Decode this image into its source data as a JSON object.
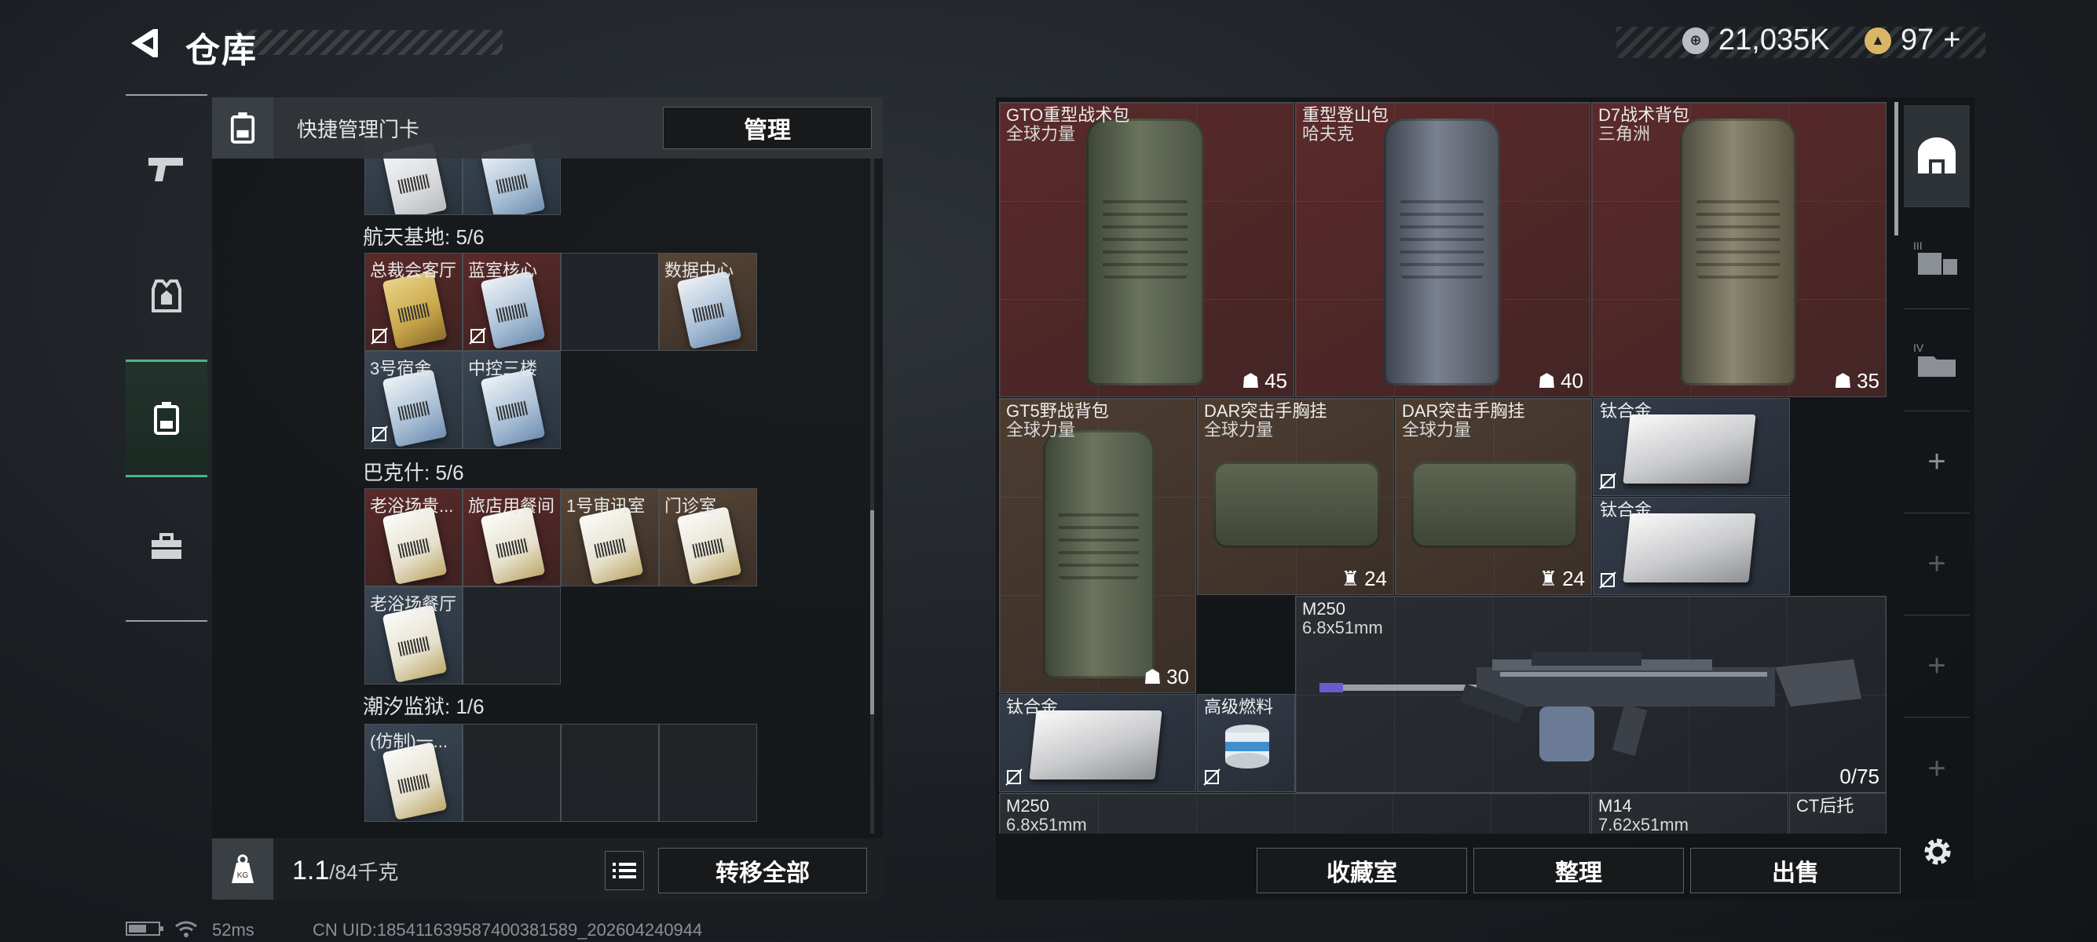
{
  "header": {
    "title": "仓库"
  },
  "currency": {
    "money": "21,035K",
    "coins": "97",
    "plus": "+"
  },
  "rail": {
    "items": [
      "weapon-icon",
      "armor-icon",
      "keycard-icon",
      "toolbox-icon"
    ]
  },
  "keycards": {
    "header_label": "快捷管理门卡",
    "manage_label": "管理",
    "groups": [
      {
        "title": "航天基地: 5/6",
        "slots": [
          "总裁会客厅",
          "蓝室核心",
          "",
          "数据中心",
          "3号宿舍",
          "中控三楼"
        ]
      },
      {
        "title": "巴克什: 5/6",
        "slots": [
          "老浴场贵...",
          "旅店用餐间",
          "1号审讯室",
          "门诊室",
          "老浴场餐厅"
        ]
      },
      {
        "title": "潮汐监狱: 1/6",
        "slots": [
          "(仿制)一..."
        ]
      }
    ],
    "weight_value": "1.1",
    "weight_max": "/84千克",
    "transfer_label": "转移全部"
  },
  "stash": {
    "items": [
      {
        "name": "GTO重型战术包",
        "sub": "全球力量",
        "cap": "45"
      },
      {
        "name": "重型登山包",
        "sub": "哈夫克",
        "cap": "40"
      },
      {
        "name": "D7战术背包",
        "sub": "三角洲",
        "cap": "35"
      },
      {
        "name": "GT5野战背包",
        "sub": "全球力量",
        "cap": "30"
      },
      {
        "name": "DAR突击手胸挂",
        "sub": "全球力量",
        "cap": "24"
      },
      {
        "name": "DAR突击手胸挂",
        "sub": "全球力量",
        "cap": "24"
      },
      {
        "name": "钛合金",
        "sub": "",
        "cap": ""
      },
      {
        "name": "钛合金",
        "sub": "",
        "cap": ""
      },
      {
        "name": "M250",
        "sub": "6.8x51mm",
        "cap": "0/75"
      },
      {
        "name": "钛合金",
        "sub": "",
        "cap": ""
      },
      {
        "name": "高级燃料",
        "sub": "",
        "cap": ""
      },
      {
        "name": "M250",
        "sub": "6.8x51mm",
        "cap": ""
      },
      {
        "name": "M14",
        "sub": "7.62x51mm",
        "cap": ""
      },
      {
        "name": "CT后托",
        "sub": "",
        "cap": ""
      }
    ],
    "buttons": {
      "collection": "收藏室",
      "sort": "整理",
      "sell": "出售"
    }
  },
  "right_tabs": {
    "tab3": "III",
    "tab4": "IV"
  },
  "status": {
    "ping": "52ms",
    "uid": "CN UID:18541163958740038158​9_202604240944"
  }
}
